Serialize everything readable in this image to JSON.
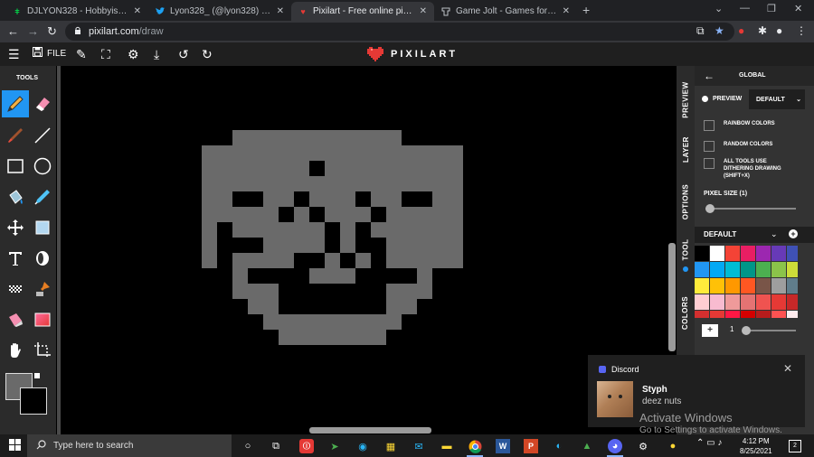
{
  "browser": {
    "tabs": [
      {
        "title": "DJLYON328 - Hobbyist, Digital Ar",
        "favicon": "deviantart-icon",
        "active": false
      },
      {
        "title": "Lyon328_ (@lyon328) / Twitter",
        "favicon": "twitter-icon",
        "active": false
      },
      {
        "title": "Pixilart - Free online pixel art dra",
        "favicon": "pixilart-icon",
        "active": true
      },
      {
        "title": "Game Jolt - Games for the love o",
        "favicon": "gamejolt-icon",
        "active": false
      }
    ],
    "url_host": "pixilart.com",
    "url_path": "/draw"
  },
  "app": {
    "file_label": "FILE",
    "logo_text": "PIXILART"
  },
  "tools": {
    "title": "TOOLS",
    "items": [
      "pencil",
      "eraser",
      "brush",
      "line",
      "rectangle",
      "circle",
      "bucket",
      "eyedropper",
      "move",
      "select",
      "text",
      "shade",
      "dither",
      "stamp",
      "lighten",
      "gradient",
      "hand",
      "crop"
    ],
    "primary_color": "#6a6a6a",
    "secondary_color": "#000000"
  },
  "side_tabs": [
    "PREVIEW",
    "LAYER",
    "OPTIONS",
    "TOOL",
    "COLORS"
  ],
  "panel": {
    "header": "GLOBAL",
    "preview_label": "PREVIEW",
    "preview_select": "DEFAULT",
    "options": [
      "RAINBOW COLORS",
      "RANDOM COLORS",
      "ALL TOOLS USE DITHERING DRAWING (SHIFT+X)"
    ],
    "pixel_size_label": "PIXEL SIZE (1)",
    "palette_name": "DEFAULT",
    "palette": [
      "#000000",
      "#ffffff",
      "#f44336",
      "#e91e63",
      "#9c27b0",
      "#673ab7",
      "#3f51b5",
      "#2196f3",
      "#03a9f4",
      "#00bcd4",
      "#009688",
      "#4caf50",
      "#8bc34a",
      "#cddc39",
      "#ffeb3b",
      "#ffc107",
      "#ff9800",
      "#ff5722",
      "#795548",
      "#9e9e9e",
      "#607d8b",
      "#ffcdd2",
      "#f8bbd0",
      "#ef9a9a",
      "#e57373",
      "#ef5350",
      "#e53935",
      "#c62828",
      "#d32f2f",
      "#e53935",
      "#ff1744",
      "#d50000",
      "#b71c1c",
      "#ff5252",
      "#ffebee"
    ],
    "brush_count": "1"
  },
  "notification": {
    "app": "Discord",
    "sender": "Styph",
    "message": "deez nuts"
  },
  "watermark": {
    "line1": "Activate Windows",
    "line2": "Go to Settings to activate Windows."
  },
  "taskbar": {
    "search_placeholder": "Type here to search",
    "time": "4:12 PM",
    "date": "8/25/2021",
    "notification_count": "2"
  },
  "canvas": {
    "pixel_color": "#6a6a6a",
    "background": "#000000",
    "rows": [
      "......##############......",
      "...###########################...",
      "...######....#########....######...",
      "...##################################",
      "...####.....##..##..##.....####",
      "...####.....#..##..##......####",
      "...####.....#.....#........####",
      "...##.....##....##......##..####"
    ]
  }
}
